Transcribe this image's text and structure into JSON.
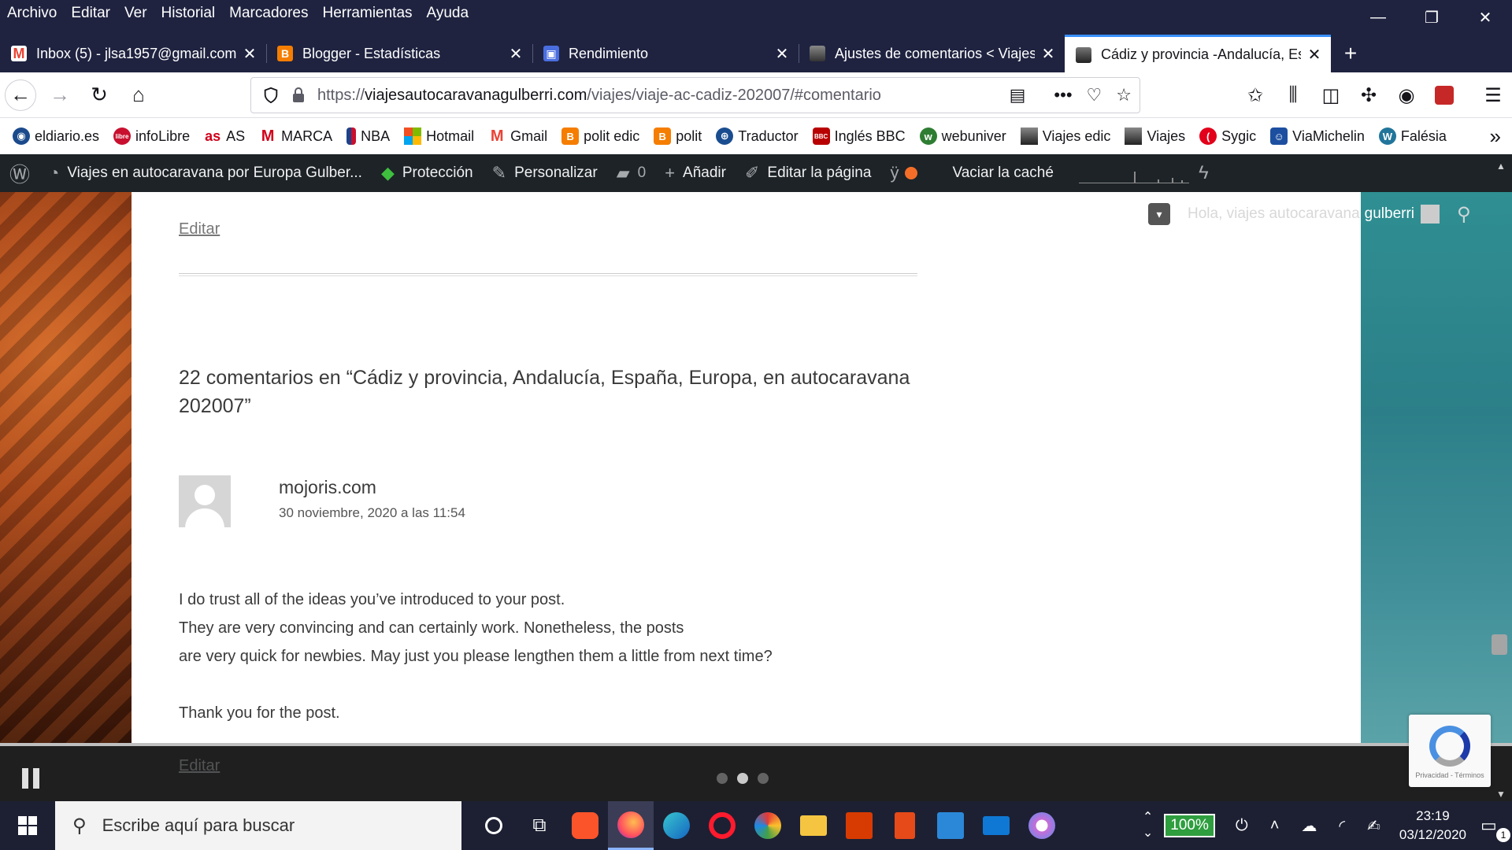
{
  "menubar": {
    "items": [
      "Archivo",
      "Editar",
      "Ver",
      "Historial",
      "Marcadores",
      "Herramientas",
      "Ayuda"
    ]
  },
  "window_controls": {
    "minimize": "—",
    "restore": "❐",
    "close": "✕"
  },
  "tabs": [
    {
      "title": "Inbox (5) - jlsa1957@gmail.com",
      "favicon": "gmail-icon",
      "color": "#ea4335"
    },
    {
      "title": "Blogger - Estadísticas",
      "favicon": "blogger-icon",
      "color": "#f57d00"
    },
    {
      "title": "Rendimiento",
      "favicon": "store-icon",
      "color": "#4a6ee0"
    },
    {
      "title": "Ajustes de comentarios < Viajes",
      "favicon": "site-thumb-icon",
      "color": "#666666"
    },
    {
      "title": "Cádiz y provincia -Andalucía, España",
      "favicon": "site-thumb-icon",
      "color": "#444444",
      "active": true
    }
  ],
  "navbar": {
    "url_scheme": "https://",
    "url_host": "viajesautocaravanagulberri.com",
    "url_path": "/viajes/viaje-ac-cadiz-202007/#comentario"
  },
  "bookmarks": [
    {
      "label": "eldiario.es",
      "color": "#1b4a8c",
      "icon": "eldiario-icon"
    },
    {
      "label": "infoLibre",
      "color": "#c8102e",
      "icon": "infolibre-icon"
    },
    {
      "label": "AS",
      "color": "#d0021b",
      "icon": "as-icon"
    },
    {
      "label": "MARCA",
      "color": "#d0021b",
      "icon": "marca-icon"
    },
    {
      "label": "NBA",
      "color": "#1d428a",
      "icon": "nba-icon"
    },
    {
      "label": "Hotmail",
      "color": "#f25022",
      "icon": "microsoft-icon"
    },
    {
      "label": "Gmail",
      "color": "#ea4335",
      "icon": "gmail-icon"
    },
    {
      "label": "polit edic",
      "color": "#f57d00",
      "icon": "blogger-icon"
    },
    {
      "label": "polit",
      "color": "#f57d00",
      "icon": "blogger-icon"
    },
    {
      "label": "Traductor",
      "color": "#1a4d8f",
      "icon": "globe-icon"
    },
    {
      "label": "Inglés BBC",
      "color": "#b80000",
      "icon": "bbc-icon"
    },
    {
      "label": "webuniver",
      "color": "#2e7d32",
      "icon": "webuniver-icon"
    },
    {
      "label": "Viajes edic",
      "color": "#444444",
      "icon": "site-thumb-icon"
    },
    {
      "label": "Viajes",
      "color": "#444444",
      "icon": "site-thumb-icon"
    },
    {
      "label": "Sygic",
      "color": "#e2001a",
      "icon": "sygic-icon"
    },
    {
      "label": "ViaMichelin",
      "color": "#1d4fa0",
      "icon": "michelin-icon"
    },
    {
      "label": "Falésia",
      "color": "#21759b",
      "icon": "wordpress-icon"
    }
  ],
  "wpbar": {
    "site_name": "Viajes en autocaravana por Europa Gulber...",
    "protection": "Protección",
    "customize": "Personalizar",
    "comments_count": "0",
    "add_new": "Añadir",
    "edit_page": "Editar la página",
    "clear_cache": "Vaciar la caché"
  },
  "user_area": {
    "greeting": "Hola, viajes autocaravana",
    "username": "gulberri"
  },
  "article": {
    "edit_label": "Editar",
    "comments_title": "22 comentarios en “Cádiz y provincia, Andalucía, España, Europa, en autocaravana 202007”",
    "comment": {
      "author": "mojoris.com",
      "date": "30 noviembre, 2020 a las 11:54",
      "paragraph1_line1": "I do trust all of the ideas you’ve introduced to your post.",
      "paragraph1_line2": "They are very convincing and can certainly work. Nonetheless, the posts",
      "paragraph1_line3": "are very quick for newbies. May just you please lengthen them a little from next time?",
      "paragraph2": "Thank you for the post.",
      "edit_label": "Editar"
    }
  },
  "recaptcha": {
    "text": "Privacidad - Términos"
  },
  "taskbar": {
    "search_placeholder": "Escribe aquí para buscar",
    "battery": "100%",
    "time": "23:19",
    "date": "03/12/2020",
    "notification_count": "1"
  }
}
